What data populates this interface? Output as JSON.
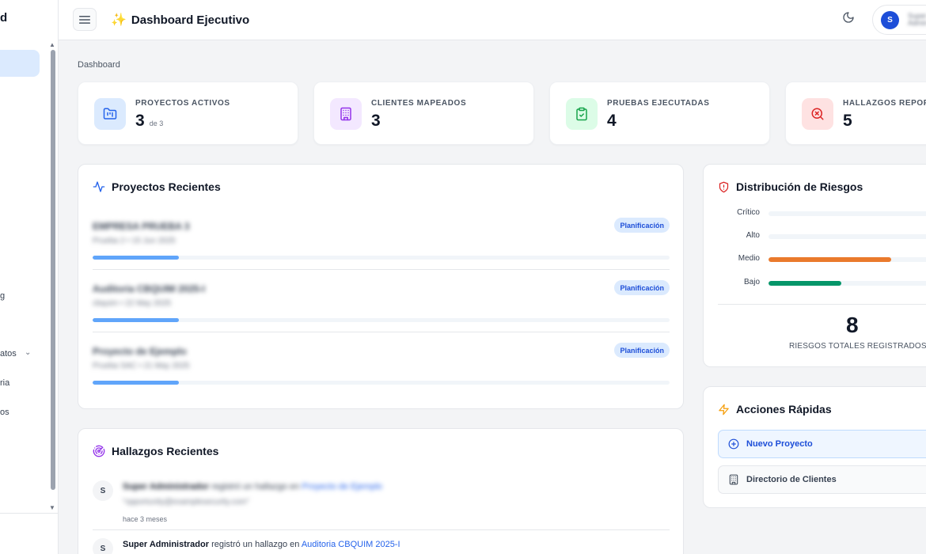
{
  "sidebar": {
    "brand": "d",
    "items": [
      "g",
      "atos",
      "ria",
      "os"
    ]
  },
  "header": {
    "title": "Dashboard Ejecutivo",
    "user_initial": "S",
    "user_name": "Super Admin"
  },
  "breadcrumb": "Dashboard",
  "stats": [
    {
      "label": "PROYECTOS ACTIVOS",
      "value": "3",
      "sub": "de 3",
      "icon": "folder-kanban-icon",
      "bg": "#dbeafe",
      "fg": "#2563eb"
    },
    {
      "label": "CLIENTES MAPEADOS",
      "value": "3",
      "sub": "",
      "icon": "building-icon",
      "bg": "#f3e8ff",
      "fg": "#9333ea"
    },
    {
      "label": "PRUEBAS EJECUTADAS",
      "value": "4",
      "sub": "",
      "icon": "clipboard-check-icon",
      "bg": "#dcfce7",
      "fg": "#16a34a"
    },
    {
      "label": "HALLAZGOS REPORT",
      "value": "5",
      "sub": "",
      "icon": "search-x-icon",
      "bg": "#fee2e2",
      "fg": "#dc2626"
    }
  ],
  "recent_projects": {
    "title": "Proyectos Recientes",
    "items": [
      {
        "name": "EMPRESA PRUEBA 3",
        "meta": "Prueba 2 • 15 Jun 2025",
        "badge": "Planificación",
        "progress": 0.15
      },
      {
        "name": "Auditoria CBQUIM 2025-I",
        "meta": "cbquim • 22 May 2025",
        "badge": "Planificación",
        "progress": 0.15
      },
      {
        "name": "Proyecto de Ejemplo",
        "meta": "Prueba SAC • 21 May 2025",
        "badge": "Planificación",
        "progress": 0.15
      }
    ]
  },
  "recent_findings": {
    "title": "Hallazgos Recientes",
    "items": [
      {
        "initial": "S",
        "user": "Super Administrador",
        "action": "registró un hallazgo en",
        "project": "Proyecto de Ejemplo",
        "detail": "\"opportunity@examplesecurity.com\"",
        "time": "hace 3 meses"
      },
      {
        "initial": "S",
        "user": "Super Administrador",
        "action": "registró un hallazgo en",
        "project": "Auditoria CBQUIM 2025-I"
      }
    ]
  },
  "risk_distribution": {
    "title": "Distribución de Riesgos",
    "levels": [
      {
        "label": "Crítico",
        "value": 0,
        "color": "#dc2626"
      },
      {
        "label": "Alto",
        "value": 0,
        "color": "#f97316"
      },
      {
        "label": "Medio",
        "value": 0.74,
        "color": "#ea7a2c"
      },
      {
        "label": "Bajo",
        "value": 0.44,
        "color": "#059669"
      }
    ],
    "total": "8",
    "total_label": "RIESGOS TOTALES REGISTRADOS"
  },
  "quick_actions": {
    "title": "Acciones Rápidas",
    "items": [
      {
        "label": "Nuevo Proyecto",
        "icon": "plus-circle-icon"
      },
      {
        "label": "Directorio de Clientes",
        "icon": "building-icon"
      }
    ]
  }
}
